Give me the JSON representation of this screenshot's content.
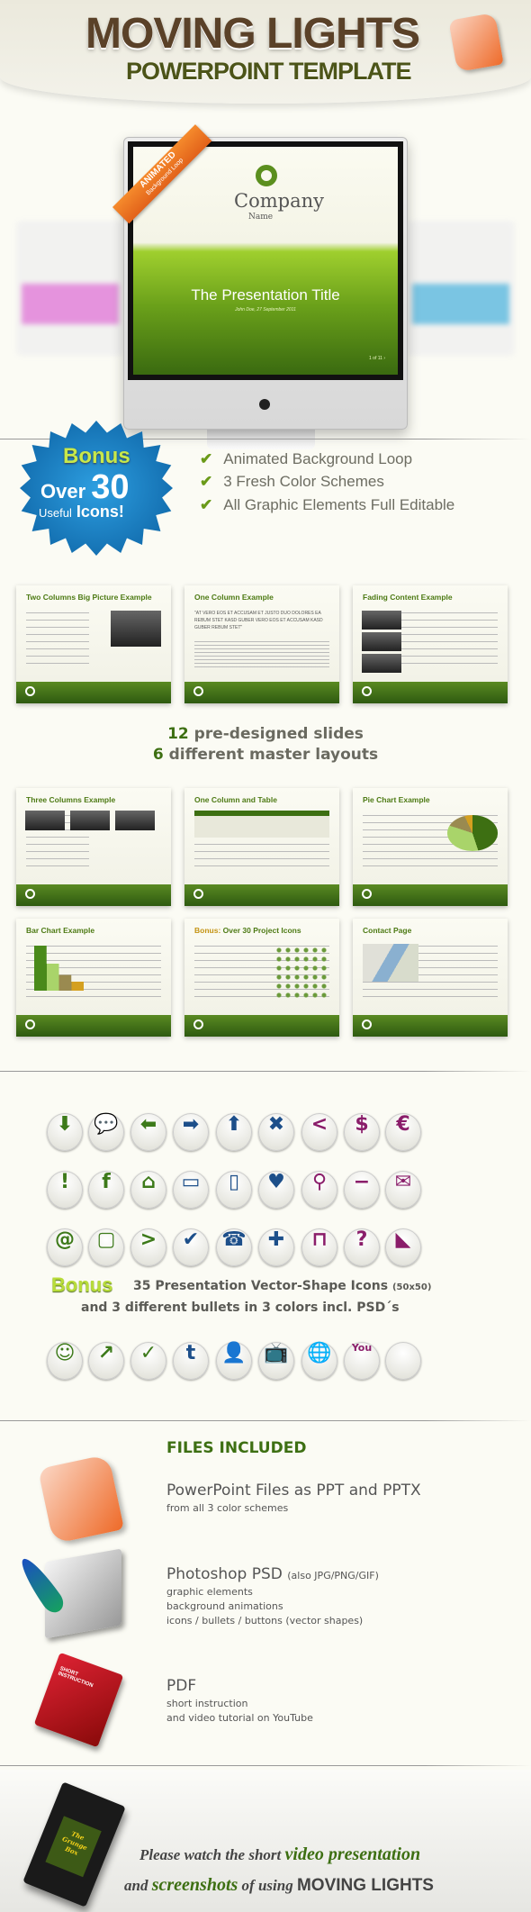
{
  "header": {
    "title": "MOVING LIGHTS",
    "subtitle": "POWERPOINT TEMPLATE"
  },
  "monitor": {
    "company": "Company",
    "company_sub": "Name",
    "slide_title": "The Presentation Title",
    "slide_subtitle": "John Doe, 27 September 2011",
    "slide_nav": "1 of 11 ›",
    "ribbon_main": "ANIMATED",
    "ribbon_sub": "Background Loop",
    "blur_colors": [
      "#e07ad8",
      "#5ab8e0"
    ]
  },
  "bonus_badge": {
    "bonus": "Bonus",
    "over": "Over",
    "count": "30",
    "useful": "Useful",
    "icons": "Icons!"
  },
  "features": [
    "Animated Background Loop",
    "3 Fresh Color Schemes",
    "All Graphic Elements Full Editable"
  ],
  "slides": [
    {
      "title": "Two Columns Big Picture Example"
    },
    {
      "title": "One Column Example",
      "quote": "\"AT VERO EOS ET ACCUSAM ET JUSTO DUO DOLORES EA REBUM STET KASD GUBER VERO EOS ET ACCUSAM KASD GUBER REBUM STET\""
    },
    {
      "title": "Fading Content Example"
    },
    {
      "title": "Three Columns Example"
    },
    {
      "title": "One Column and Table"
    },
    {
      "title": "Pie Chart Example"
    },
    {
      "title": "Bar Chart Example"
    },
    {
      "title_accent": "Bonus:",
      "title": "Over 30 Project Icons"
    },
    {
      "title": "Contact Page"
    }
  ],
  "slides_summary": {
    "line1_num": "12",
    "line1": "pre-designed slides",
    "line2_num": "6",
    "line2": "different master layouts"
  },
  "icons": [
    {
      "name": "arrow-down",
      "glyph": "⬇",
      "color": "#3d7a1a"
    },
    {
      "name": "speech-bubble",
      "glyph": "💬",
      "color": "#3d7a1a"
    },
    {
      "name": "arrow-left",
      "glyph": "⬅",
      "color": "#3d7a1a"
    },
    {
      "name": "arrow-right",
      "glyph": "➡",
      "color": "#1d4f8a"
    },
    {
      "name": "arrow-up",
      "glyph": "⬆",
      "color": "#1d4f8a"
    },
    {
      "name": "close",
      "glyph": "✖",
      "color": "#1d4f8a"
    },
    {
      "name": "chevron-left",
      "glyph": "<",
      "color": "#8a1d6a"
    },
    {
      "name": "dollar",
      "glyph": "$",
      "color": "#8a1d6a"
    },
    {
      "name": "euro",
      "glyph": "€",
      "color": "#8a1d6a"
    },
    {
      "name": "exclamation",
      "glyph": "!",
      "color": "#3d7a1a"
    },
    {
      "name": "facebook",
      "glyph": "f",
      "color": "#3d7a1a"
    },
    {
      "name": "home",
      "glyph": "⌂",
      "color": "#3d7a1a"
    },
    {
      "name": "tablet",
      "glyph": "▭",
      "color": "#1d4f8a"
    },
    {
      "name": "smartphone",
      "glyph": "▯",
      "color": "#1d4f8a"
    },
    {
      "name": "heart",
      "glyph": "♥",
      "color": "#1d4f8a"
    },
    {
      "name": "map-pin",
      "glyph": "⚲",
      "color": "#8a1d6a"
    },
    {
      "name": "minus",
      "glyph": "−",
      "color": "#8a1d6a"
    },
    {
      "name": "mail",
      "glyph": "✉",
      "color": "#8a1d6a"
    },
    {
      "name": "at-sign",
      "glyph": "@",
      "color": "#3d7a1a"
    },
    {
      "name": "monitor",
      "glyph": "▢",
      "color": "#3d7a1a"
    },
    {
      "name": "chevron-right",
      "glyph": ">",
      "color": "#3d7a1a"
    },
    {
      "name": "checkmark",
      "glyph": "✔",
      "color": "#1d4f8a"
    },
    {
      "name": "telephone",
      "glyph": "☎",
      "color": "#1d4f8a"
    },
    {
      "name": "plus",
      "glyph": "✚",
      "color": "#1d4f8a"
    },
    {
      "name": "presentation-board",
      "glyph": "⊓",
      "color": "#8a1d6a"
    },
    {
      "name": "question",
      "glyph": "?",
      "color": "#8a1d6a"
    },
    {
      "name": "rss",
      "glyph": "◣",
      "color": "#8a1d6a"
    }
  ],
  "bonus_icons": {
    "bonus": "Bonus",
    "line1": "35 Presentation Vector-Shape Icons",
    "size": "(50x50)",
    "line2": "and 3 different bullets in 3 colors incl. PSD´s"
  },
  "bonus_row": [
    {
      "name": "smiley",
      "glyph": "☺",
      "color": "#3d7a1a"
    },
    {
      "name": "trend-chart",
      "glyph": "↗",
      "color": "#3d7a1a"
    },
    {
      "name": "check-circle",
      "glyph": "✓",
      "color": "#3d7a1a"
    },
    {
      "name": "twitter",
      "glyph": "t",
      "color": "#1d4f8a"
    },
    {
      "name": "user",
      "glyph": "👤",
      "color": "#1d4f8a"
    },
    {
      "name": "tv",
      "glyph": "📺",
      "color": "#1d4f8a"
    },
    {
      "name": "globe",
      "glyph": "🌐",
      "color": "#8a1d6a"
    },
    {
      "name": "youtube",
      "glyph": "You",
      "color": "#8a1d6a"
    },
    {
      "name": "blank",
      "glyph": "",
      "color": "#ccc"
    }
  ],
  "files": {
    "heading": "FILES INCLUDED",
    "items": [
      {
        "title": "PowerPoint Files as PPT and PPTX",
        "lines": [
          "from all 3 color schemes"
        ]
      },
      {
        "title": "Photoshop PSD",
        "title_note": "(also JPG/PNG/GIF)",
        "lines": [
          "graphic elements",
          "background animations",
          "icons / bullets / buttons (vector shapes)"
        ]
      },
      {
        "title": "PDF",
        "lines": [
          "short instruction",
          "and video tutorial on YouTube"
        ],
        "book_label": "SHORT INSTRUCTION"
      }
    ]
  },
  "video": {
    "a": "Please watch the short",
    "b": "video presentation",
    "c": "and",
    "d": "screenshots",
    "e": "of using",
    "f": "MOVING LIGHTS",
    "tape_label": "The Grunge Box"
  }
}
